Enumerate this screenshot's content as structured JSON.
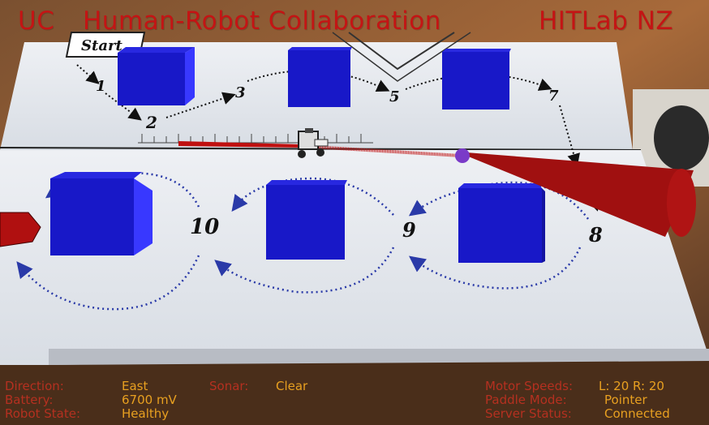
{
  "header": {
    "left": "UC",
    "center": "Human-Robot Collaboration",
    "right": "HITLab NZ"
  },
  "map": {
    "start_label": "Start",
    "waypoints": [
      "1",
      "2",
      "3",
      "5",
      "7",
      "8",
      "9",
      "10"
    ]
  },
  "status": {
    "direction": {
      "label": "Direction:",
      "value": "East"
    },
    "battery": {
      "label": "Battery:",
      "value": "6700 mV"
    },
    "robot_state": {
      "label": "Robot State:",
      "value": "Healthy"
    },
    "sonar": {
      "label": "Sonar:",
      "value": "Clear"
    },
    "motor_speeds": {
      "label": "Motor Speeds:",
      "value": "L: 20 R: 20"
    },
    "paddle_mode": {
      "label": "Paddle Mode:",
      "value": "Pointer"
    },
    "server_status": {
      "label": "Server Status:",
      "value": "Connected"
    }
  },
  "colors": {
    "title": "#c41414",
    "label": "#b53020",
    "value": "#e8a020",
    "box": "#1818c8"
  }
}
